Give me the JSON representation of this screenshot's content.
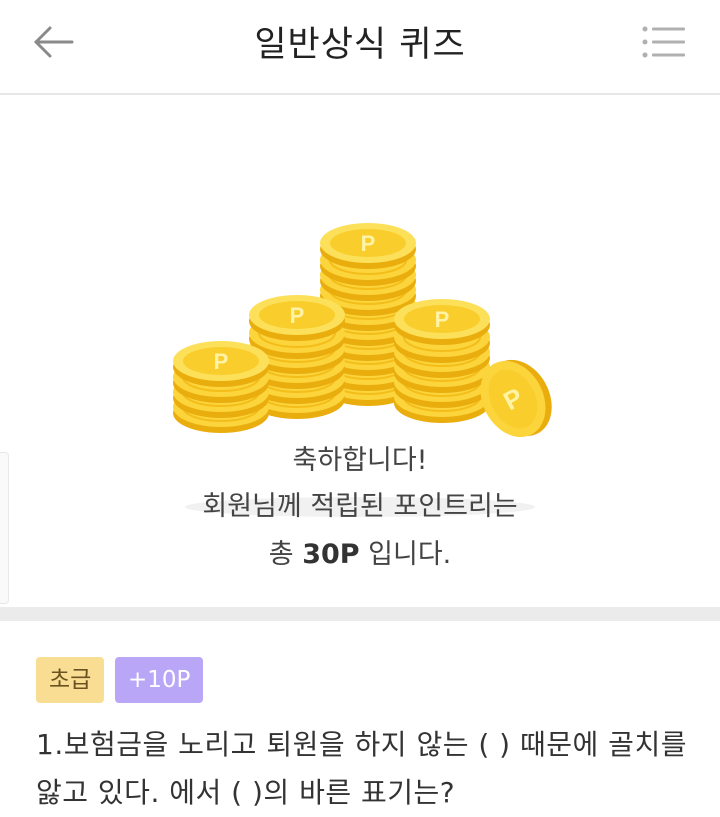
{
  "header": {
    "title": "일반상식 퀴즈",
    "back_icon": "arrow-left-icon",
    "menu_icon": "list-menu-icon"
  },
  "reward": {
    "image": "coin-stack-icon",
    "line1": "축하합니다!",
    "line2": "회원님께 적립된 포인트리는",
    "line3_prefix": "총 ",
    "line3_points": "30P",
    "line3_suffix": " 입니다."
  },
  "quiz": {
    "level_badge": "초급",
    "points_badge": "+10P",
    "question": "1.보험금을 노리고 퇴원을 하지 않는 ( ) 때문에 골치를 앓고 있다. 에서 ( )의 바른 표기는?"
  },
  "colors": {
    "coin": "#fbd23a",
    "level_badge": "#f9dd93",
    "points_badge": "#b9a6f6",
    "divider": "#ebebeb"
  }
}
